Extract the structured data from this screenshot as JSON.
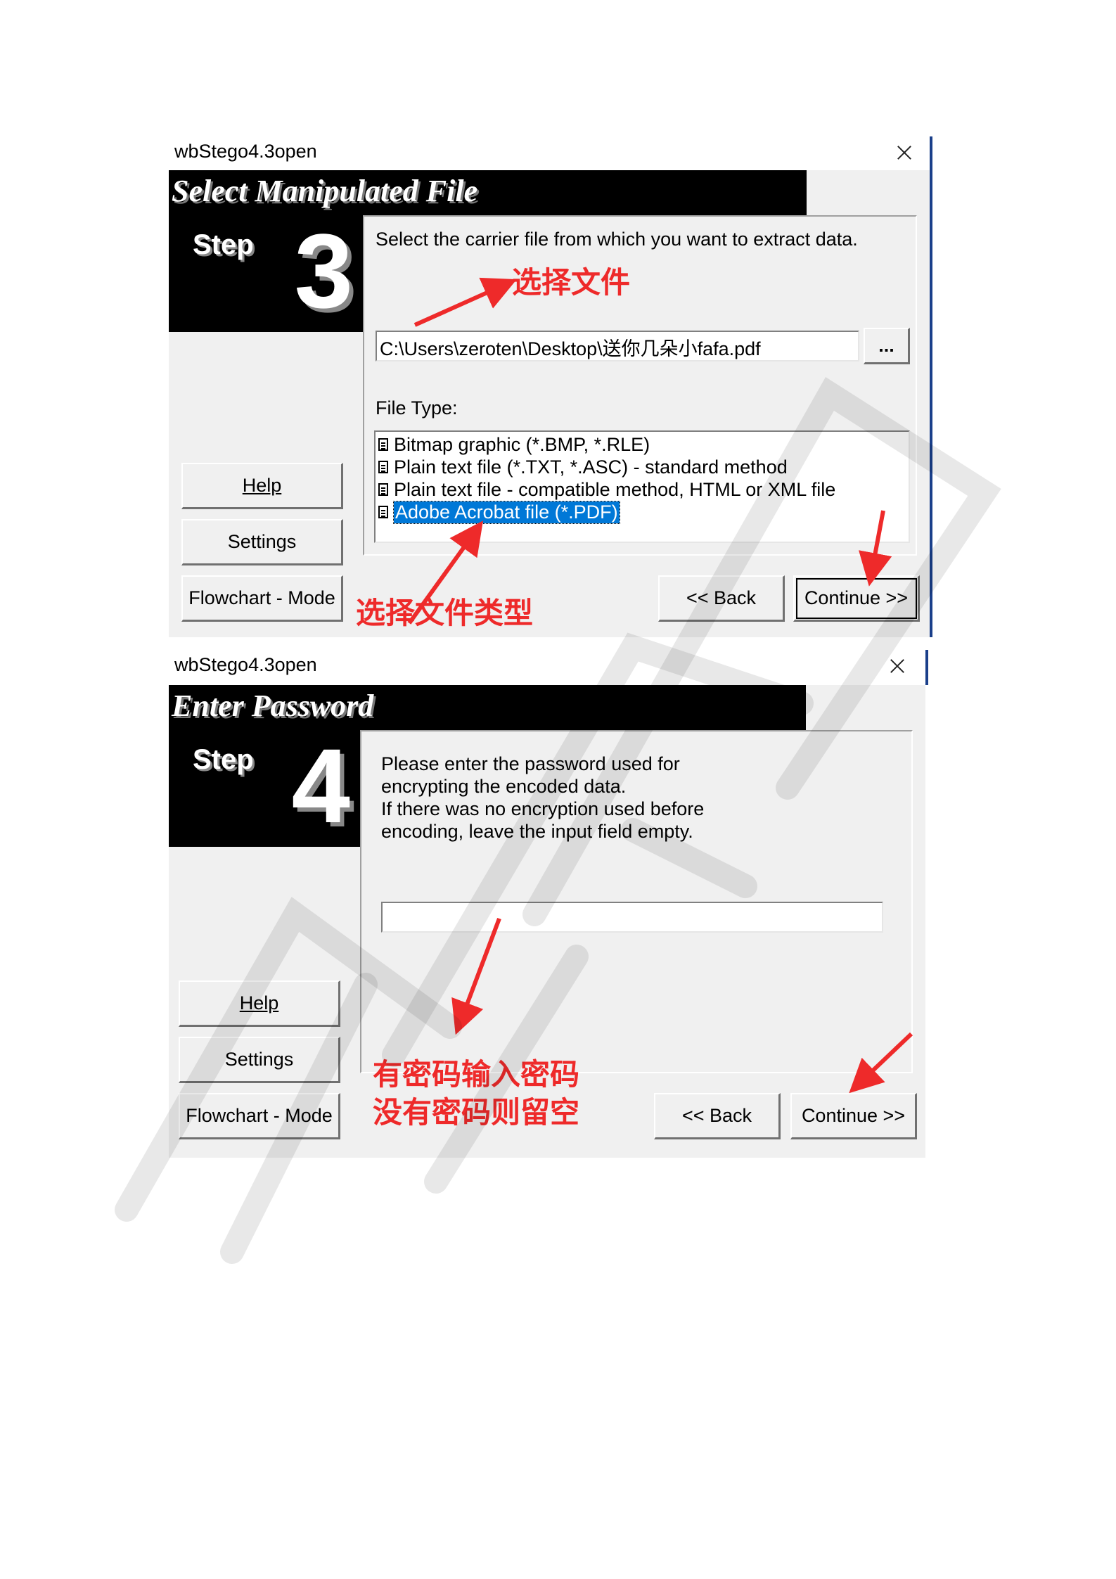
{
  "window1": {
    "title": "wbStego4.3open",
    "banner": "Select Manipulated File",
    "step_label": "Step",
    "step_number": "3",
    "description": "Select the carrier file from which you want to extract data.",
    "file_path": "C:\\Users\\zeroten\\Desktop\\送你几朵小fafa.pdf",
    "browse_label": "...",
    "file_type_label": "File Type:",
    "file_types": [
      "Bitmap graphic (*.BMP, *.RLE)",
      "Plain text file (*.TXT, *.ASC) - standard method",
      "Plain text file - compatible method, HTML or XML file",
      "Adobe Acrobat file (*.PDF)"
    ],
    "selected_file_type": "Adobe Acrobat file (*.PDF)",
    "help_label": "Help",
    "settings_label": "Settings",
    "flowchart_label": "Flowchart - Mode",
    "back_label": "<< Back",
    "continue_label": "Continue >>",
    "annotation_select_file": "选择文件",
    "annotation_select_type": "选择文件类型"
  },
  "window2": {
    "title": "wbStego4.3open",
    "banner": "Enter Password",
    "step_label": "Step",
    "step_number": "4",
    "description": "Please enter the password used for\nencrypting the encoded data.\nIf there was no encryption used before\nencoding, leave the input field empty.",
    "password_value": "",
    "help_label": "Help",
    "settings_label": "Settings",
    "flowchart_label": "Flowchart - Mode",
    "back_label": "<< Back",
    "continue_label": "Continue >>",
    "annotation_line1": "有密码输入密码",
    "annotation_line2": "没有密码则留空"
  },
  "colors": {
    "annotation_red": "#ee2a2a",
    "selection_blue": "#0078d7",
    "dialog_gray": "#f0f0f0"
  }
}
